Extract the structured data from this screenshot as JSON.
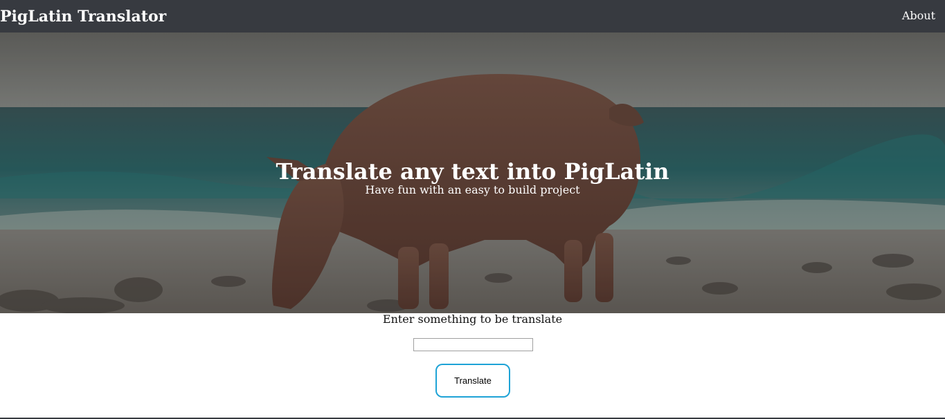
{
  "navbar": {
    "brand": "PigLatin Translator",
    "about_label": "About",
    "background": "#373a40"
  },
  "hero": {
    "title": "Translate any text into PigLatin",
    "subtitle": "Have fun with an easy to build project",
    "image": "pig-on-beach-photo"
  },
  "form": {
    "prompt": "Enter something to be translate",
    "input_value": "",
    "input_placeholder": "",
    "button_label": "Translate",
    "button_border_color": "#1ea3d6"
  }
}
